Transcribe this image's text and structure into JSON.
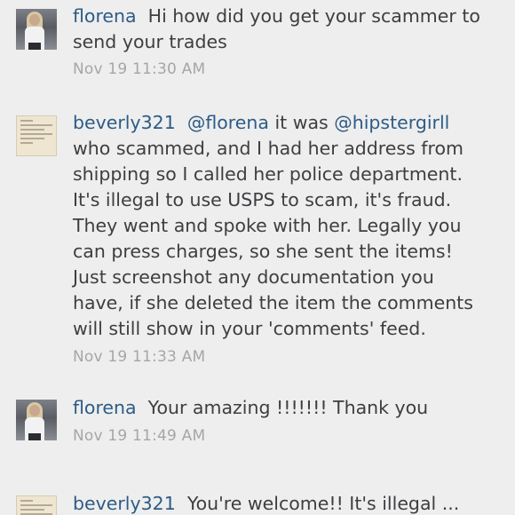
{
  "comments": [
    {
      "username": "florena",
      "body": "Hi how did you get your scammer to send your trades",
      "timestamp": "Nov 19 11:30 AM",
      "avatar_icon": "user-photo-avatar"
    },
    {
      "username": "beverly321",
      "mention_1": "@florena",
      "text_1": " it was ",
      "mention_2": "@hipstergirll",
      "text_2": " who scammed, and I had her address from shipping so I called her police department. It's illegal to use USPS to scam, it's fraud. They went and spoke with her. Legally you can press charges, so she sent the items! Just screenshot any documentation you have, if she deleted the item the comments will still show in your 'comments' feed.",
      "timestamp": "Nov 19 11:33 AM",
      "avatar_icon": "document-avatar"
    },
    {
      "username": "florena",
      "body": "Your amazing !!!!!!! Thank you",
      "timestamp": "Nov 19 11:49 AM",
      "avatar_icon": "user-photo-avatar"
    },
    {
      "username": "beverly321",
      "body": "You're welcome!! It's illegal ...",
      "avatar_icon": "document-avatar"
    }
  ],
  "colors": {
    "background": "#eeeeee",
    "username": "#2d5c86",
    "body_text": "#3e3e42",
    "timestamp": "#a6a6a9"
  }
}
